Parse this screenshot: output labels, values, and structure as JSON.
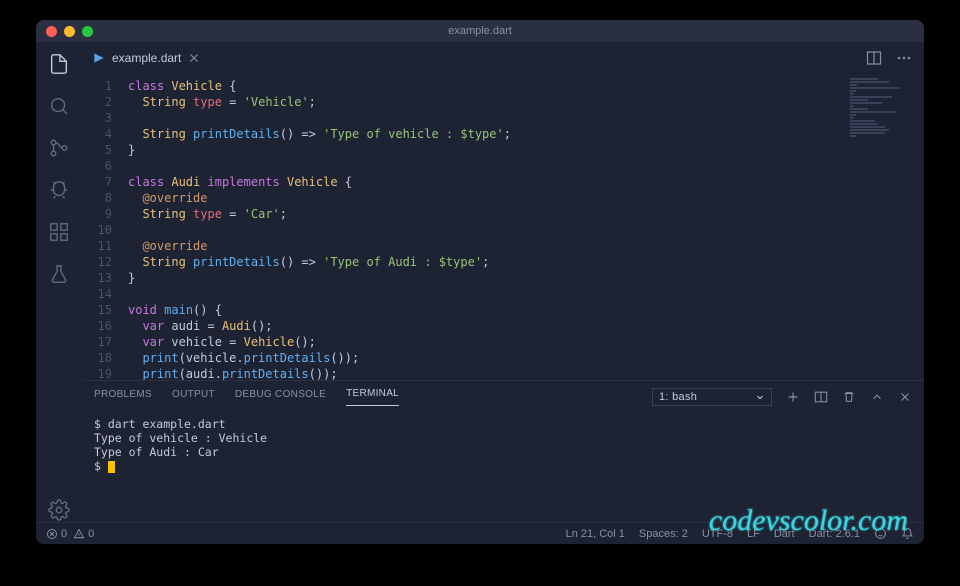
{
  "window": {
    "title": "example.dart"
  },
  "tab": {
    "filename": "example.dart"
  },
  "code": {
    "lines": 20,
    "tokens": [
      [
        [
          "kw",
          "class "
        ],
        [
          "cls",
          "Vehicle"
        ],
        [
          "op",
          " {"
        ]
      ],
      [
        [
          "op",
          "  "
        ],
        [
          "type",
          "String"
        ],
        [
          "op",
          " "
        ],
        [
          "var",
          "type"
        ],
        [
          "op",
          " = "
        ],
        [
          "str",
          "'Vehicle'"
        ],
        [
          "op",
          ";"
        ]
      ],
      [],
      [
        [
          "op",
          "  "
        ],
        [
          "type",
          "String"
        ],
        [
          "op",
          " "
        ],
        [
          "fn",
          "printDetails"
        ],
        [
          "op",
          "() => "
        ],
        [
          "str",
          "'Type of vehicle : $type'"
        ],
        [
          "op",
          ";"
        ]
      ],
      [
        [
          "op",
          "}"
        ]
      ],
      [],
      [
        [
          "kw",
          "class "
        ],
        [
          "cls",
          "Audi"
        ],
        [
          "op",
          " "
        ],
        [
          "kw",
          "implements"
        ],
        [
          "op",
          " "
        ],
        [
          "cls",
          "Vehicle"
        ],
        [
          "op",
          " {"
        ]
      ],
      [
        [
          "op",
          "  "
        ],
        [
          "ann",
          "@override"
        ]
      ],
      [
        [
          "op",
          "  "
        ],
        [
          "type",
          "String"
        ],
        [
          "op",
          " "
        ],
        [
          "var",
          "type"
        ],
        [
          "op",
          " = "
        ],
        [
          "str",
          "'Car'"
        ],
        [
          "op",
          ";"
        ]
      ],
      [],
      [
        [
          "op",
          "  "
        ],
        [
          "ann",
          "@override"
        ]
      ],
      [
        [
          "op",
          "  "
        ],
        [
          "type",
          "String"
        ],
        [
          "op",
          " "
        ],
        [
          "fn",
          "printDetails"
        ],
        [
          "op",
          "() => "
        ],
        [
          "str",
          "'Type of Audi : $type'"
        ],
        [
          "op",
          ";"
        ]
      ],
      [
        [
          "op",
          "}"
        ]
      ],
      [],
      [
        [
          "kw",
          "void"
        ],
        [
          "op",
          " "
        ],
        [
          "fn",
          "main"
        ],
        [
          "op",
          "() {"
        ]
      ],
      [
        [
          "op",
          "  "
        ],
        [
          "kw",
          "var"
        ],
        [
          "op",
          " audi = "
        ],
        [
          "cls",
          "Audi"
        ],
        [
          "op",
          "();"
        ]
      ],
      [
        [
          "op",
          "  "
        ],
        [
          "kw",
          "var"
        ],
        [
          "op",
          " vehicle = "
        ],
        [
          "cls",
          "Vehicle"
        ],
        [
          "op",
          "();"
        ]
      ],
      [
        [
          "op",
          "  "
        ],
        [
          "fn",
          "print"
        ],
        [
          "op",
          "(vehicle."
        ],
        [
          "fn",
          "printDetails"
        ],
        [
          "op",
          "());"
        ]
      ],
      [
        [
          "op",
          "  "
        ],
        [
          "fn",
          "print"
        ],
        [
          "op",
          "(audi."
        ],
        [
          "fn",
          "printDetails"
        ],
        [
          "op",
          "());"
        ]
      ],
      [
        [
          "op",
          "}"
        ]
      ]
    ]
  },
  "panel": {
    "tabs": {
      "problems": "PROBLEMS",
      "output": "OUTPUT",
      "debug": "DEBUG CONSOLE",
      "terminal": "TERMINAL"
    },
    "terminal_selector": "1: bash",
    "terminal_lines": [
      "$ dart example.dart",
      "Type of vehicle : Vehicle",
      "Type of Audi : Car",
      "$ "
    ]
  },
  "status": {
    "errors": "0",
    "warnings": "0",
    "position": "Ln 21, Col 1",
    "spaces": "Spaces: 2",
    "encoding": "UTF-8",
    "eol": "LF",
    "language": "Dart",
    "sdk": "Dart: 2.6.1"
  },
  "watermark": "codevscolor.com"
}
